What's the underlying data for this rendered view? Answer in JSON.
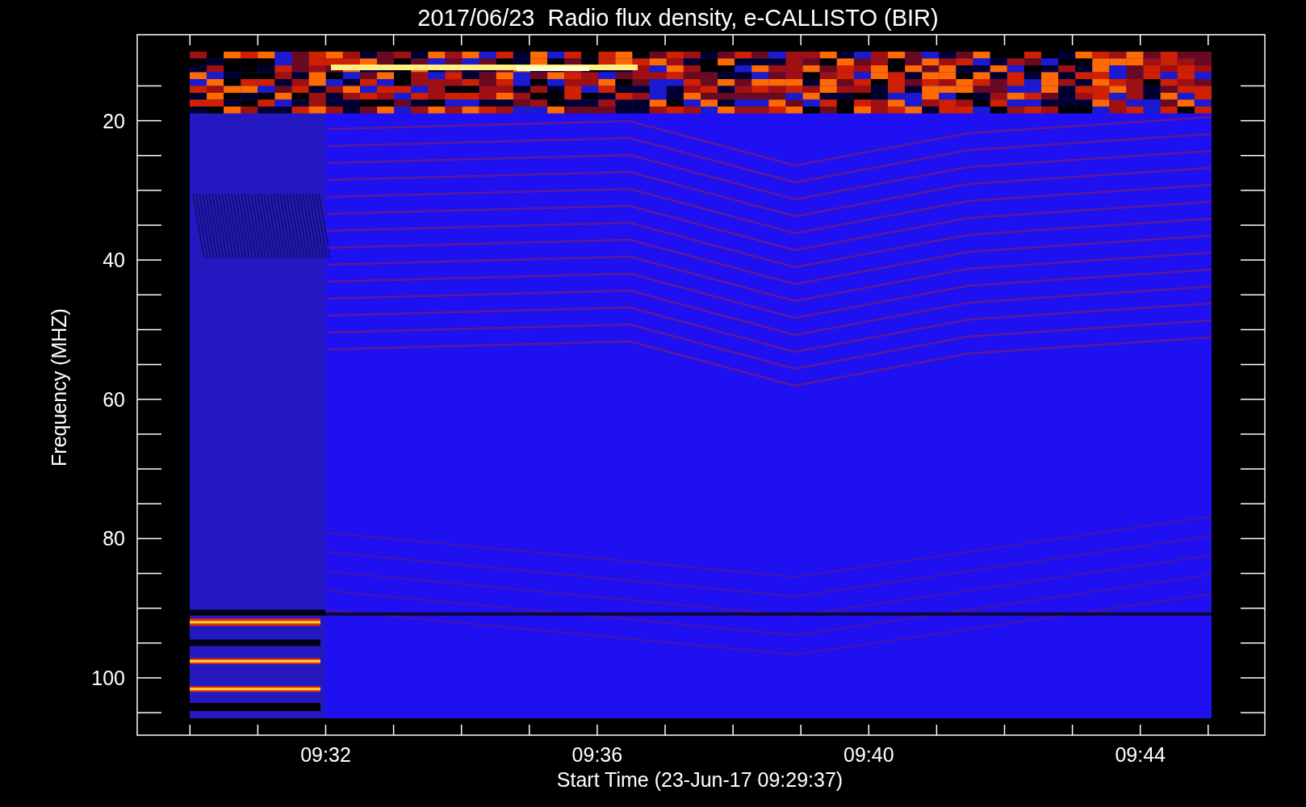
{
  "title": "2017/06/23  Radio flux density, e-CALLISTO (BIR)",
  "y_axis": {
    "label": "Frequency (MHZ)",
    "ticks": [
      "20",
      "40",
      "60",
      "80",
      "100"
    ]
  },
  "x_axis": {
    "label": "Start Time (23-Jun-17 09:29:37)",
    "ticks": [
      "09:32",
      "09:36",
      "09:40",
      "09:44"
    ]
  }
}
